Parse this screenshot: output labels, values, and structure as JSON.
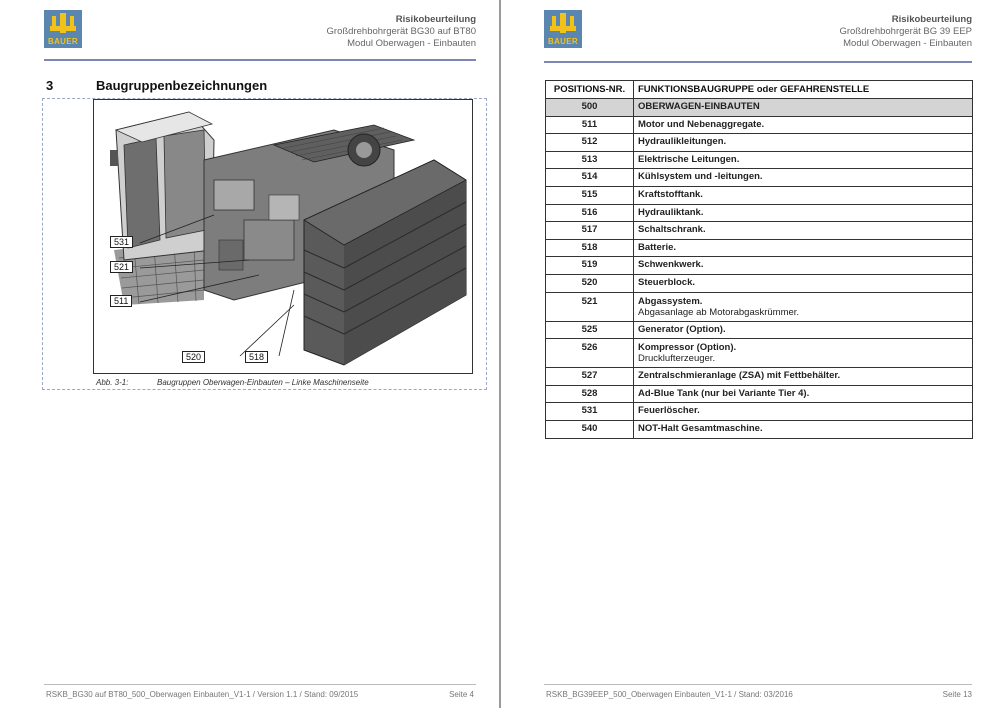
{
  "brand": {
    "logo_text": "BAUER",
    "accent": "#5b86b0",
    "logo_yellow": "#f2c21a"
  },
  "left_page": {
    "header": {
      "line1": "Risikobeurteilung",
      "line2": "Großdrehbohrgerät BG30 auf BT80",
      "line3": "Modul Oberwagen - Einbauten"
    },
    "section": {
      "number": "3",
      "title": "Baugruppenbezeichnungen"
    },
    "figure": {
      "caption_prefix": "Abb. 3-1:",
      "caption": "Baugruppen Oberwagen-Einbauten – Linke Maschinenseite",
      "callouts": [
        "531",
        "521",
        "511",
        "520",
        "518"
      ]
    },
    "footer": {
      "doc": "RSKB_BG30 auf BT80_500_Oberwagen Einbauten_V1-1 / Version 1.1 / Stand: 09/2015",
      "page": "Seite 4"
    }
  },
  "right_page": {
    "header": {
      "line1": "Risikobeurteilung",
      "line2": "Großdrehbohrgerät BG 39 EEP",
      "line3": "Modul Oberwagen - Einbauten"
    },
    "table": {
      "col1": "POSITIONS-NR.",
      "col2": "FUNKTIONSBAUGRUPPE  oder  GEFAHRENSTELLE",
      "rows": [
        {
          "nr": "500",
          "label": "OBERWAGEN-EINBAUTEN",
          "sub": ""
        },
        {
          "nr": "511",
          "label": "Motor und Nebenaggregate.",
          "sub": ""
        },
        {
          "nr": "512",
          "label": "Hydraulikleitungen.",
          "sub": ""
        },
        {
          "nr": "513",
          "label": "Elektrische Leitungen.",
          "sub": ""
        },
        {
          "nr": "514",
          "label": "Kühlsystem und -leitungen.",
          "sub": ""
        },
        {
          "nr": "515",
          "label": "Kraftstofftank.",
          "sub": ""
        },
        {
          "nr": "516",
          "label": "Hydrauliktank.",
          "sub": ""
        },
        {
          "nr": "517",
          "label": "Schaltschrank.",
          "sub": ""
        },
        {
          "nr": "518",
          "label": "Batterie.",
          "sub": ""
        },
        {
          "nr": "519",
          "label": "Schwenkwerk.",
          "sub": ""
        },
        {
          "nr": "520",
          "label": "Steuerblock.",
          "sub": ""
        },
        {
          "nr": "521",
          "label": "Abgassystem.",
          "sub": "Abgasanlage  ab Motorabgaskrümmer."
        },
        {
          "nr": "525",
          "label": "Generator (Option).",
          "sub": ""
        },
        {
          "nr": "526",
          "label": "Kompressor (Option).",
          "sub": "Drucklufterzeuger."
        },
        {
          "nr": "527",
          "label": "Zentralschmieranlage (ZSA) mit Fettbehälter.",
          "sub": ""
        },
        {
          "nr": "528",
          "label": "Ad-Blue Tank (nur bei Variante Tier 4).",
          "sub": ""
        },
        {
          "nr": "531",
          "label": "Feuerlöscher.",
          "sub": ""
        },
        {
          "nr": "540",
          "label": "NOT-Halt Gesamtmaschine.",
          "sub": ""
        }
      ]
    },
    "footer": {
      "doc": "RSKB_BG39EEP_500_Oberwagen Einbauten_V1-1 / Stand: 03/2016",
      "page": "Seite 13"
    }
  }
}
